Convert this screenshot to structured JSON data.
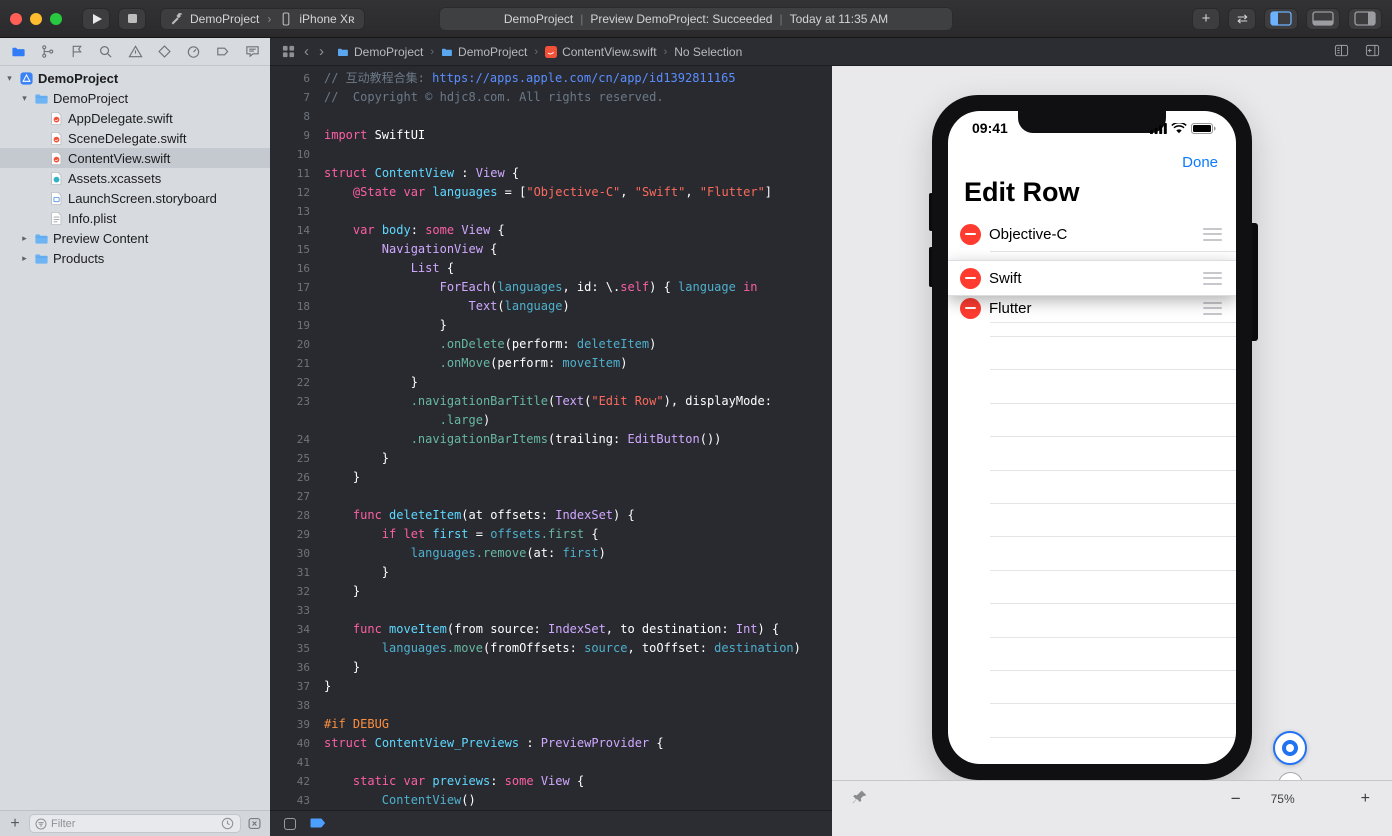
{
  "colors": {
    "accent_blue": "#2f7cf6",
    "run_status_ok": "#d4d4d5",
    "editor_background": "#292a30",
    "keyword": "#fc5fa3",
    "string": "#fc6a5d",
    "comment": "#6c7986",
    "system_type": "#d0a8ff",
    "declaration": "#5dd8ff",
    "preprocessor": "#fd8f3f",
    "delete_red": "#ff3b30",
    "ios_blue": "#0a7aff"
  },
  "toolbar": {
    "scheme": "DemoProject",
    "device": "iPhone Xʀ",
    "add_label": "+",
    "status": {
      "project": "DemoProject",
      "separator": "|",
      "message": "Preview DemoProject: Succeeded",
      "time": "Today at 11:35 AM"
    }
  },
  "navigator": {
    "tabs": [
      "project",
      "source-control",
      "symbols",
      "search",
      "issues",
      "tests",
      "debug",
      "breakpoints",
      "reports"
    ],
    "selected_tab_index": 0,
    "items": [
      {
        "label": "DemoProject",
        "level": 0,
        "icon": "xcode-project",
        "disclosure": "open",
        "selected": false
      },
      {
        "label": "DemoProject",
        "level": 1,
        "icon": "folder",
        "disclosure": "open",
        "selected": false
      },
      {
        "label": "AppDelegate.swift",
        "level": 2,
        "icon": "swift-file",
        "selected": false
      },
      {
        "label": "SceneDelegate.swift",
        "level": 2,
        "icon": "swift-file",
        "selected": false
      },
      {
        "label": "ContentView.swift",
        "level": 2,
        "icon": "swift-file",
        "selected": true
      },
      {
        "label": "Assets.xcassets",
        "level": 2,
        "icon": "assets",
        "selected": false
      },
      {
        "label": "LaunchScreen.storyboard",
        "level": 2,
        "icon": "storyboard",
        "selected": false
      },
      {
        "label": "Info.plist",
        "level": 2,
        "icon": "plist",
        "selected": false
      },
      {
        "label": "Preview Content",
        "level": 1,
        "icon": "folder",
        "disclosure": "closed",
        "selected": false
      },
      {
        "label": "Products",
        "level": 1,
        "icon": "folder",
        "disclosure": "closed",
        "selected": false
      }
    ],
    "filter_placeholder": "Filter"
  },
  "jumpbar": {
    "crumbs": [
      {
        "label": "DemoProject",
        "icon": "folder"
      },
      {
        "label": "DemoProject",
        "icon": "folder"
      },
      {
        "label": "ContentView.swift",
        "icon": "swift"
      },
      {
        "label": "No Selection",
        "icon": null
      }
    ]
  },
  "editor": {
    "lines": [
      {
        "n": "6",
        "s": [
          [
            "comment",
            "// 互动教程合集: "
          ],
          [
            "url",
            "https://apps.apple.com/cn/app/id1392811165"
          ]
        ]
      },
      {
        "n": "7",
        "s": [
          [
            "comment",
            "//  Copyright © hdjc8.com. All rights reserved."
          ]
        ]
      },
      {
        "n": "8",
        "s": []
      },
      {
        "n": "9",
        "s": [
          [
            "keyword",
            "import"
          ],
          [
            "plain",
            " SwiftUI"
          ]
        ]
      },
      {
        "n": "10",
        "s": []
      },
      {
        "n": "11",
        "s": [
          [
            "keyword",
            "struct"
          ],
          [
            "plain",
            " "
          ],
          [
            "decl",
            "ContentView"
          ],
          [
            "plain",
            " : "
          ],
          [
            "type",
            "View"
          ],
          [
            "plain",
            " {"
          ]
        ]
      },
      {
        "n": "12",
        "s": [
          [
            "plain",
            "    "
          ],
          [
            "keyword",
            "@State"
          ],
          [
            "plain",
            " "
          ],
          [
            "keyword",
            "var"
          ],
          [
            "plain",
            " "
          ],
          [
            "decl",
            "languages"
          ],
          [
            "plain",
            " = ["
          ],
          [
            "string",
            "\"Objective-C\""
          ],
          [
            "plain",
            ", "
          ],
          [
            "string",
            "\"Swift\""
          ],
          [
            "plain",
            ", "
          ],
          [
            "string",
            "\"Flutter\""
          ],
          [
            "plain",
            "]"
          ]
        ]
      },
      {
        "n": "13",
        "s": []
      },
      {
        "n": "14",
        "s": [
          [
            "plain",
            "    "
          ],
          [
            "keyword",
            "var"
          ],
          [
            "plain",
            " "
          ],
          [
            "decl",
            "body"
          ],
          [
            "plain",
            ": "
          ],
          [
            "keyword",
            "some"
          ],
          [
            "plain",
            " "
          ],
          [
            "type",
            "View"
          ],
          [
            "plain",
            " {"
          ]
        ]
      },
      {
        "n": "15",
        "s": [
          [
            "plain",
            "        "
          ],
          [
            "type",
            "NavigationView"
          ],
          [
            "plain",
            " {"
          ]
        ]
      },
      {
        "n": "16",
        "s": [
          [
            "plain",
            "            "
          ],
          [
            "type",
            "List"
          ],
          [
            "plain",
            " {"
          ]
        ]
      },
      {
        "n": "17",
        "s": [
          [
            "plain",
            "                "
          ],
          [
            "type",
            "ForEach"
          ],
          [
            "plain",
            "("
          ],
          [
            "ref",
            "languages"
          ],
          [
            "plain",
            ", id: \\."
          ],
          [
            "keyword",
            "self"
          ],
          [
            "plain",
            ") { "
          ],
          [
            "ref",
            "language"
          ],
          [
            "plain",
            " "
          ],
          [
            "keyword",
            "in"
          ]
        ]
      },
      {
        "n": "18",
        "s": [
          [
            "plain",
            "                    "
          ],
          [
            "type",
            "Text"
          ],
          [
            "plain",
            "("
          ],
          [
            "ref",
            "language"
          ],
          [
            "plain",
            ")"
          ]
        ]
      },
      {
        "n": "19",
        "s": [
          [
            "plain",
            "                }"
          ]
        ]
      },
      {
        "n": "20",
        "s": [
          [
            "plain",
            "                "
          ],
          [
            "method",
            ".onDelete"
          ],
          [
            "plain",
            "(perform: "
          ],
          [
            "ref",
            "deleteItem"
          ],
          [
            "plain",
            ")"
          ]
        ]
      },
      {
        "n": "21",
        "s": [
          [
            "plain",
            "                "
          ],
          [
            "method",
            ".onMove"
          ],
          [
            "plain",
            "(perform: "
          ],
          [
            "ref",
            "moveItem"
          ],
          [
            "plain",
            ")"
          ]
        ]
      },
      {
        "n": "22",
        "s": [
          [
            "plain",
            "            }"
          ]
        ]
      },
      {
        "n": "23",
        "s": [
          [
            "plain",
            "            "
          ],
          [
            "method",
            ".navigationBarTitle"
          ],
          [
            "plain",
            "("
          ],
          [
            "type",
            "Text"
          ],
          [
            "plain",
            "("
          ],
          [
            "string",
            "\"Edit Row\""
          ],
          [
            "plain",
            "), displayMode:"
          ]
        ]
      },
      {
        "n": "",
        "s": [
          [
            "plain",
            "                "
          ],
          [
            "method",
            ".large"
          ],
          [
            "plain",
            ")"
          ]
        ]
      },
      {
        "n": "24",
        "s": [
          [
            "plain",
            "            "
          ],
          [
            "method",
            ".navigationBarItems"
          ],
          [
            "plain",
            "(trailing: "
          ],
          [
            "type",
            "EditButton"
          ],
          [
            "plain",
            "())"
          ]
        ]
      },
      {
        "n": "25",
        "s": [
          [
            "plain",
            "        }"
          ]
        ]
      },
      {
        "n": "26",
        "s": [
          [
            "plain",
            "    }"
          ]
        ]
      },
      {
        "n": "27",
        "s": []
      },
      {
        "n": "28",
        "s": [
          [
            "plain",
            "    "
          ],
          [
            "keyword",
            "func"
          ],
          [
            "plain",
            " "
          ],
          [
            "decl",
            "deleteItem"
          ],
          [
            "plain",
            "(at offsets: "
          ],
          [
            "type",
            "IndexSet"
          ],
          [
            "plain",
            ") {"
          ]
        ]
      },
      {
        "n": "29",
        "s": [
          [
            "plain",
            "        "
          ],
          [
            "keyword",
            "if"
          ],
          [
            "plain",
            " "
          ],
          [
            "keyword",
            "let"
          ],
          [
            "plain",
            " "
          ],
          [
            "decl",
            "first"
          ],
          [
            "plain",
            " = "
          ],
          [
            "ref",
            "offsets"
          ],
          [
            "method",
            ".first"
          ],
          [
            "plain",
            " {"
          ]
        ]
      },
      {
        "n": "30",
        "s": [
          [
            "plain",
            "            "
          ],
          [
            "ref",
            "languages"
          ],
          [
            "method",
            ".remove"
          ],
          [
            "plain",
            "(at: "
          ],
          [
            "ref",
            "first"
          ],
          [
            "plain",
            ")"
          ]
        ]
      },
      {
        "n": "31",
        "s": [
          [
            "plain",
            "        }"
          ]
        ]
      },
      {
        "n": "32",
        "s": [
          [
            "plain",
            "    }"
          ]
        ]
      },
      {
        "n": "33",
        "s": []
      },
      {
        "n": "34",
        "s": [
          [
            "plain",
            "    "
          ],
          [
            "keyword",
            "func"
          ],
          [
            "plain",
            " "
          ],
          [
            "decl",
            "moveItem"
          ],
          [
            "plain",
            "(from source: "
          ],
          [
            "type",
            "IndexSet"
          ],
          [
            "plain",
            ", to destination: "
          ],
          [
            "type",
            "Int"
          ],
          [
            "plain",
            ") {"
          ]
        ]
      },
      {
        "n": "35",
        "s": [
          [
            "plain",
            "        "
          ],
          [
            "ref",
            "languages"
          ],
          [
            "method",
            ".move"
          ],
          [
            "plain",
            "(fromOffsets: "
          ],
          [
            "ref",
            "source"
          ],
          [
            "plain",
            ", toOffset: "
          ],
          [
            "ref",
            "destination"
          ],
          [
            "plain",
            ")"
          ]
        ]
      },
      {
        "n": "36",
        "s": [
          [
            "plain",
            "    }"
          ]
        ]
      },
      {
        "n": "37",
        "s": [
          [
            "plain",
            "}"
          ]
        ]
      },
      {
        "n": "38",
        "s": []
      },
      {
        "n": "39",
        "s": [
          [
            "preproc",
            "#if DEBUG"
          ]
        ]
      },
      {
        "n": "40",
        "s": [
          [
            "keyword",
            "struct"
          ],
          [
            "plain",
            " "
          ],
          [
            "decl",
            "ContentView_Previews"
          ],
          [
            "plain",
            " : "
          ],
          [
            "type",
            "PreviewProvider"
          ],
          [
            "plain",
            " {"
          ]
        ]
      },
      {
        "n": "41",
        "s": []
      },
      {
        "n": "42",
        "s": [
          [
            "plain",
            "    "
          ],
          [
            "keyword",
            "static"
          ],
          [
            "plain",
            " "
          ],
          [
            "keyword",
            "var"
          ],
          [
            "plain",
            " "
          ],
          [
            "decl",
            "previews"
          ],
          [
            "plain",
            ": "
          ],
          [
            "keyword",
            "some"
          ],
          [
            "plain",
            " "
          ],
          [
            "type",
            "View"
          ],
          [
            "plain",
            " {"
          ]
        ]
      },
      {
        "n": "43",
        "s": [
          [
            "plain",
            "        "
          ],
          [
            "ref",
            "ContentView"
          ],
          [
            "plain",
            "()"
          ]
        ]
      }
    ]
  },
  "canvas": {
    "phone": {
      "status_time": "09:41",
      "edit_button": "Done",
      "nav_title": "Edit Row",
      "rows": [
        {
          "label": "Objective-C",
          "dragging": false
        },
        {
          "label": "Swift",
          "dragging": true
        },
        {
          "label": "Flutter",
          "dragging": false
        }
      ],
      "empty_row_count": 13
    },
    "zoom_out_label": "−",
    "zoom": "75%",
    "zoom_in_label": "+"
  }
}
